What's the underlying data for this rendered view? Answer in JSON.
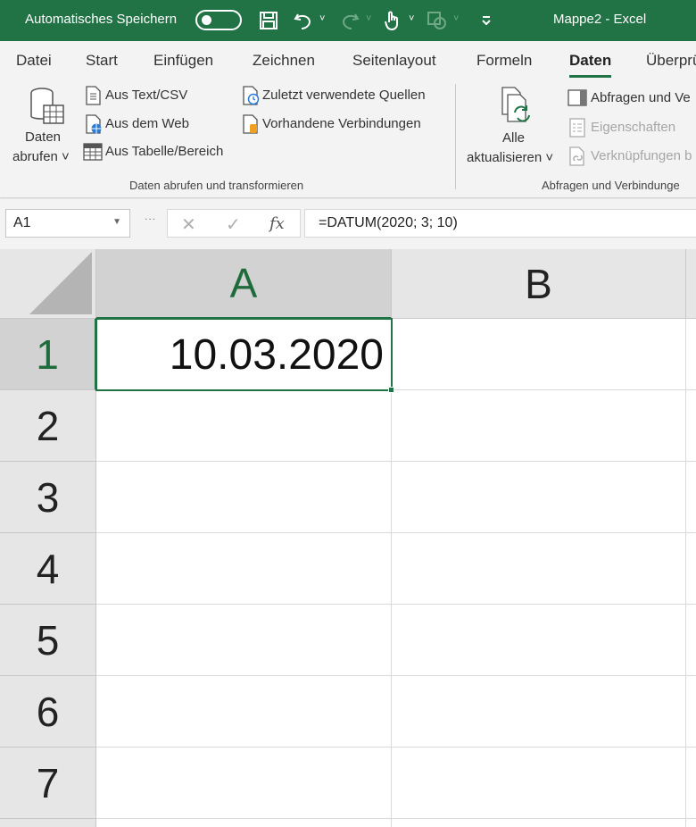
{
  "titlebar": {
    "autosave_label": "Automatisches Speichern",
    "autosave_state": "off",
    "document_title": "Mappe2  -  Excel",
    "icons": [
      "save-icon",
      "undo-icon",
      "redo-icon",
      "touch-mode-icon",
      "shapes-icon",
      "customize-icon"
    ]
  },
  "tabs": [
    {
      "label": "Datei"
    },
    {
      "label": "Start"
    },
    {
      "label": "Einfügen"
    },
    {
      "label": "Zeichnen"
    },
    {
      "label": "Seitenlayout"
    },
    {
      "label": "Formeln"
    },
    {
      "label": "Daten",
      "active": true
    },
    {
      "label": "Überprü"
    }
  ],
  "ribbon": {
    "get_data": {
      "line1": "Daten",
      "line2": "abrufen ˅"
    },
    "from_text": "Aus Text/CSV",
    "from_web": "Aus dem Web",
    "from_table": "Aus Tabelle/Bereich",
    "recent_sources": "Zuletzt verwendete Quellen",
    "existing_connections": "Vorhandene Verbindungen",
    "group1_label": "Daten abrufen und transformieren",
    "refresh_all": {
      "line1": "Alle",
      "line2": "aktualisieren ˅"
    },
    "queries_connections": "Abfragen und Ve",
    "properties": "Eigenschaften",
    "edit_links": "Verknüpfungen b",
    "group2_label": "Abfragen und Verbindunge"
  },
  "formula_bar": {
    "name_box": "A1",
    "cancel": "✕",
    "enter": "✓",
    "fx": "fx",
    "formula": "=DATUM(2020; 3; 10)"
  },
  "sheet": {
    "columns": [
      "A",
      "B"
    ],
    "rows": [
      "1",
      "2",
      "3",
      "4",
      "5",
      "6",
      "7"
    ],
    "active_cell": "A1",
    "a1_value": "10.03.2020"
  }
}
